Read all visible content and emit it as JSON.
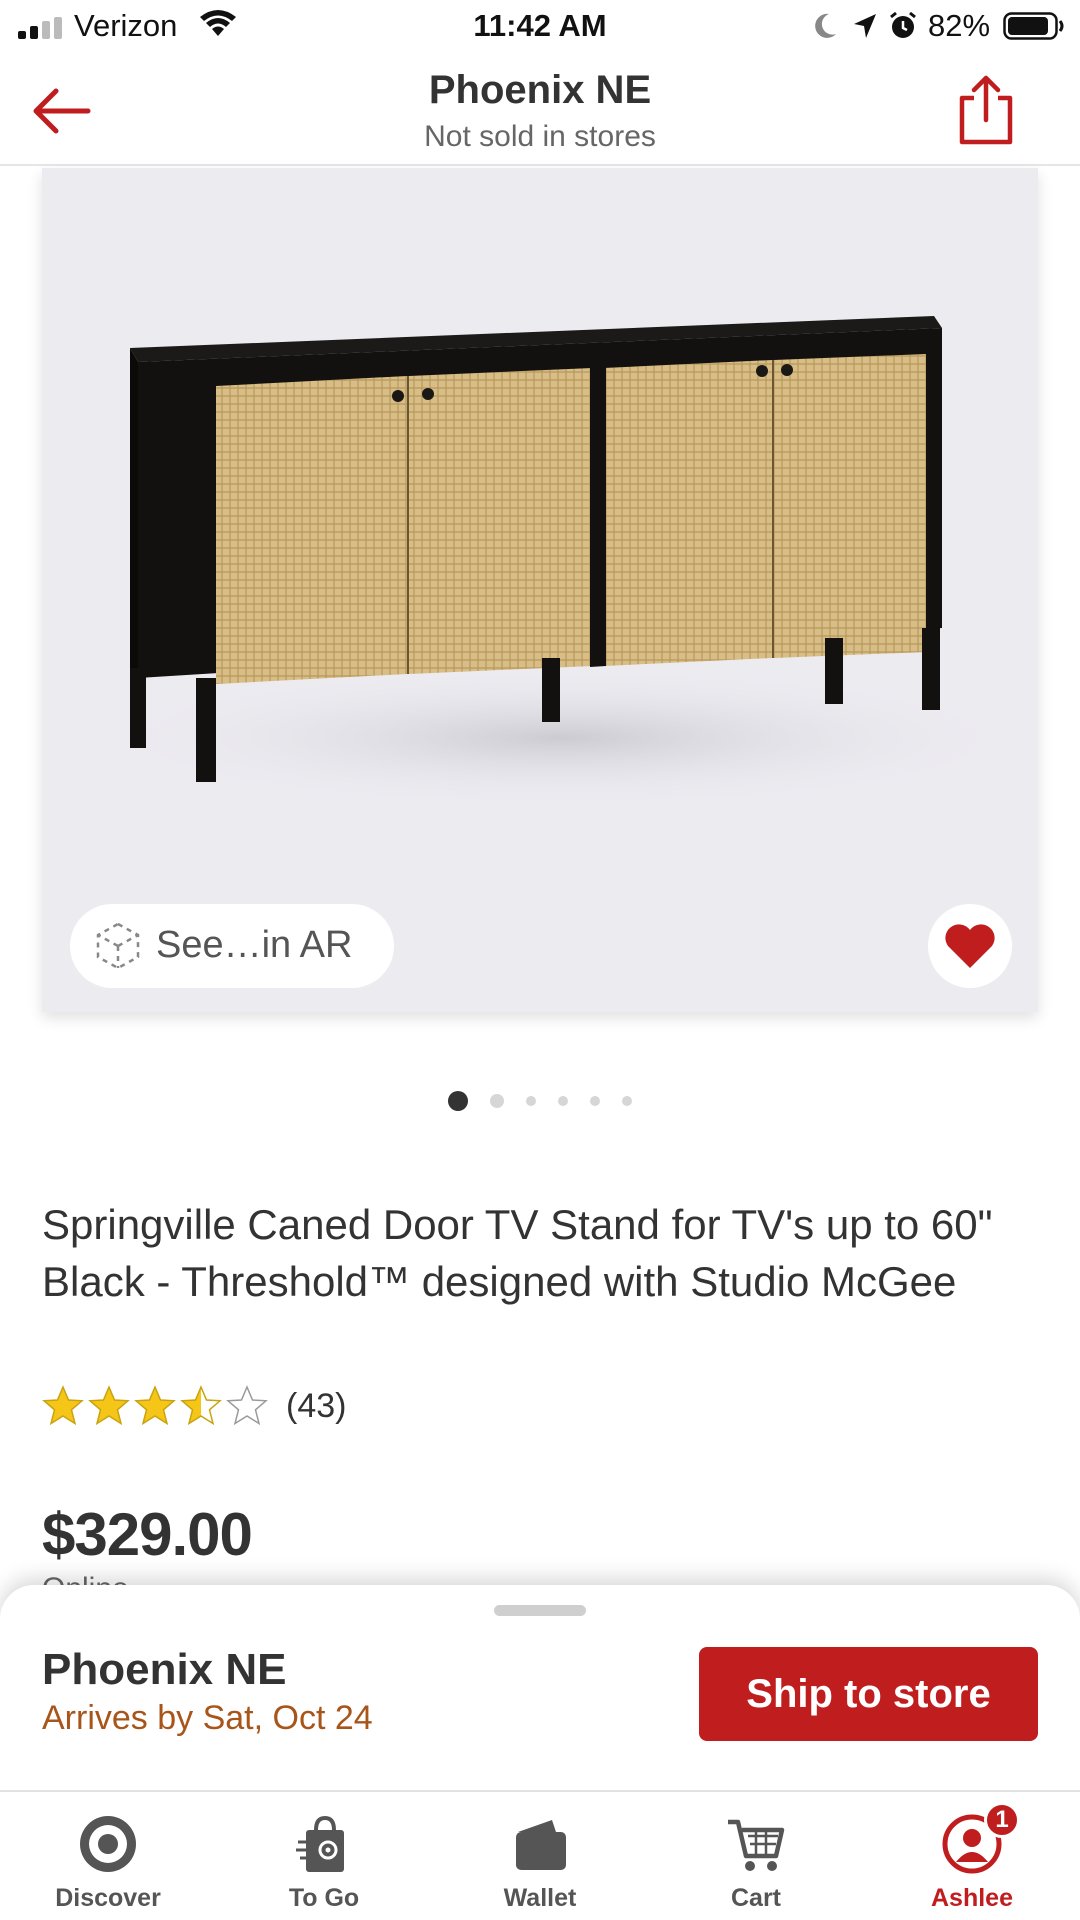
{
  "status_bar": {
    "carrier": "Verizon",
    "time": "11:42 AM",
    "battery_percent": "82%"
  },
  "header": {
    "title": "Phoenix NE",
    "subtitle": "Not sold in stores",
    "back_icon": "arrow-left-icon",
    "share_icon": "share-icon"
  },
  "gallery": {
    "ar_label": "See…in AR",
    "ar_icon": "ar-cube-icon",
    "favorite_icon": "heart-icon",
    "image_count": 6,
    "active_index": 0
  },
  "product": {
    "title": "Springville Caned Door TV Stand for TV's up to 60\" Black - Threshold™ designed with Studio McGee",
    "rating": 3.5,
    "rating_max": 5,
    "review_count": "(43)",
    "price": "$329.00",
    "price_note": "Online"
  },
  "fulfillment": {
    "store": "Phoenix NE",
    "arrival": "Arrives by Sat, Oct 24",
    "action_label": "Ship to store"
  },
  "bottom_nav": {
    "items": [
      {
        "label": "Discover",
        "icon": "target-bullseye-icon"
      },
      {
        "label": "To Go",
        "icon": "bag-icon"
      },
      {
        "label": "Wallet",
        "icon": "wallet-icon"
      },
      {
        "label": "Cart",
        "icon": "cart-icon"
      },
      {
        "label": "Ashlee",
        "icon": "account-icon",
        "badge": "1",
        "active": true
      }
    ]
  },
  "colors": {
    "brand_red": "#c01d1f",
    "arrival_text": "#a8551a",
    "star_fill": "#f5c518"
  }
}
